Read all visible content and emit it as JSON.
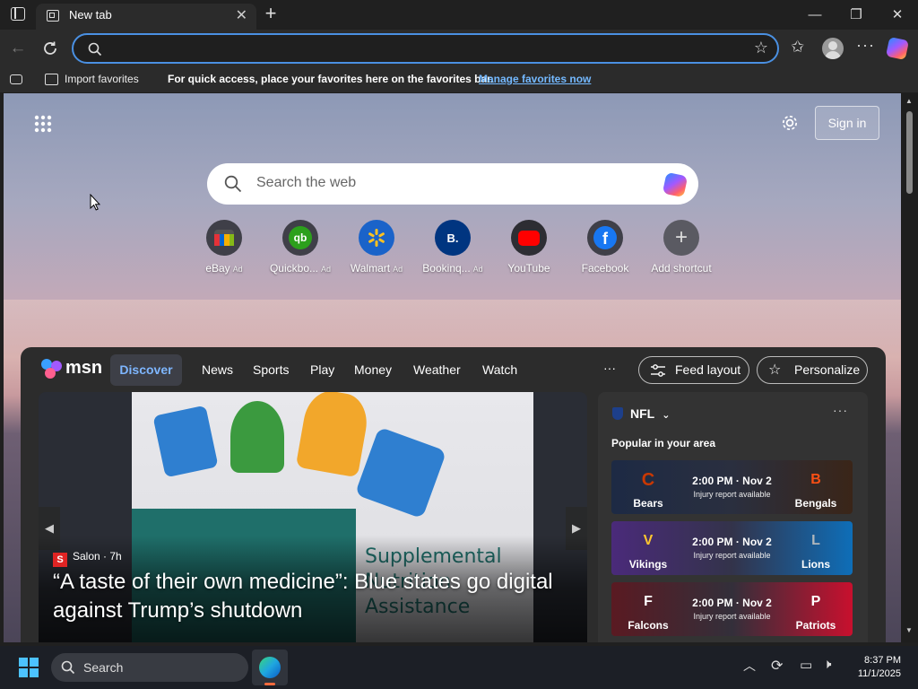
{
  "browser": {
    "tab_title": "New tab",
    "address_placeholder": "",
    "favorites_bar": {
      "import_label": "Import favorites",
      "message": "For quick access, place your favorites here on the favorites bar.",
      "manage_link": "Manage favorites now"
    }
  },
  "newtab": {
    "sign_in_label": "Sign in",
    "search_placeholder": "Search the web",
    "shortcuts": [
      {
        "label": "eBay",
        "ad": "Ad",
        "icon": "ebay-bag-icon"
      },
      {
        "label": "Quickbo...",
        "ad": "Ad",
        "icon": "quickbooks-icon"
      },
      {
        "label": "Walmart",
        "ad": "Ad",
        "icon": "walmart-spark-icon"
      },
      {
        "label": "Bookinq...",
        "ad": "Ad",
        "icon": "booking-icon"
      },
      {
        "label": "YouTube",
        "ad": "",
        "icon": "youtube-icon"
      },
      {
        "label": "Facebook",
        "ad": "",
        "icon": "facebook-icon"
      },
      {
        "label": "Add shortcut",
        "ad": "",
        "icon": "plus-icon"
      }
    ]
  },
  "feed": {
    "brand": "msn",
    "nav": [
      "Discover",
      "News",
      "Sports",
      "Play",
      "Money",
      "Weather",
      "Watch"
    ],
    "more": "···",
    "feed_layout_label": "Feed layout",
    "personalize_label": "Personalize",
    "hero": {
      "source_icon": "S",
      "source": "Salon · 7h",
      "headline": "“A taste of their own medicine”: Blue states go digital against Trump’s shutdown"
    },
    "nfl": {
      "title": "NFL",
      "more": "···",
      "subtitle": "Popular in your area",
      "games": [
        {
          "home": "Bears",
          "away": "Bengals",
          "time": "2:00 PM · Nov 2",
          "note": "Injury report available"
        },
        {
          "home": "Vikings",
          "away": "Lions",
          "time": "2:00 PM · Nov 2",
          "note": "Injury report available"
        },
        {
          "home": "Falcons",
          "away": "Patriots",
          "time": "2:00 PM · Nov 2",
          "note": "Injury report available"
        }
      ]
    }
  },
  "taskbar": {
    "search_label": "Search",
    "time": "8:37 PM",
    "date": "11/1/2025"
  },
  "colors": {
    "accent": "#4a90e2",
    "link": "#74b9ff",
    "discover": "#7eb6ff"
  }
}
